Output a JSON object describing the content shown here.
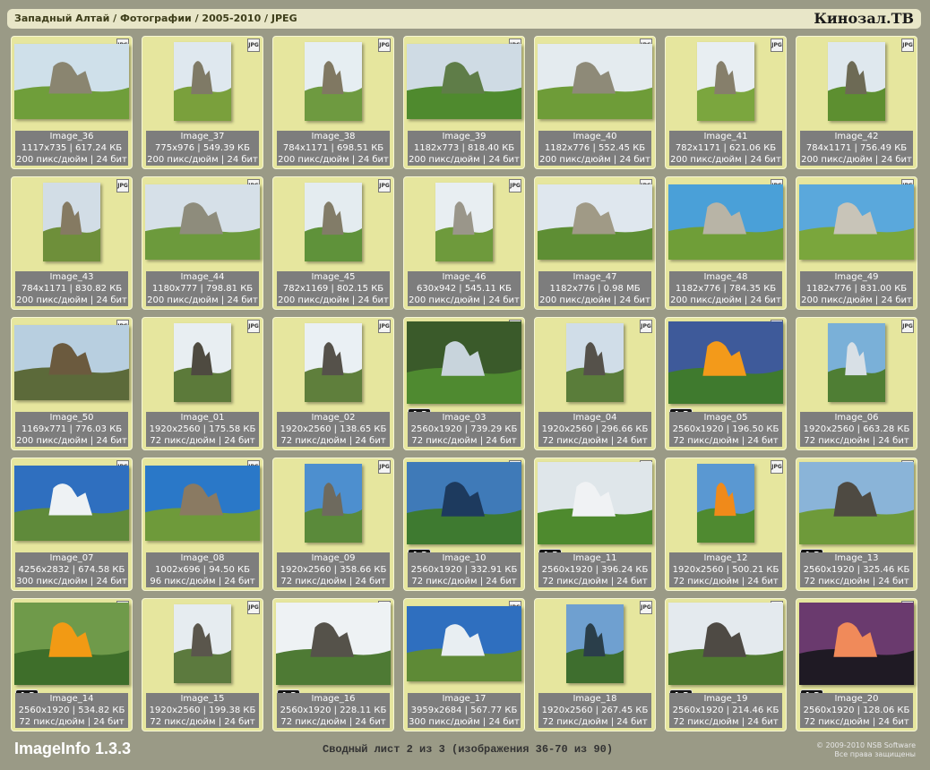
{
  "header": {
    "breadcrumb": "Западный Алтай / Фотографии / 2005-2010 / JPEG",
    "brand": "Кинозал.ТВ"
  },
  "badge_label": "JPG",
  "images": [
    {
      "name": "Image_36",
      "dims": "1117x735 | 617.24 КБ",
      "meta": "200 пикс/дюйм | 24 бит",
      "orient": "land",
      "ratio": "",
      "sky": "#cfe0ea",
      "ground": "#6f9e3a",
      "rock": "#8a8570"
    },
    {
      "name": "Image_37",
      "dims": "775x976 | 549.39 КБ",
      "meta": "200 пикс/дюйм | 24 бит",
      "orient": "port",
      "ratio": "",
      "sky": "#dfe8ef",
      "ground": "#7aa03c",
      "rock": "#7f7a66"
    },
    {
      "name": "Image_38",
      "dims": "784x1171 | 698.51 КБ",
      "meta": "200 пикс/дюйм | 24 бит",
      "orient": "port",
      "ratio": "",
      "sky": "#e6eef2",
      "ground": "#6e9a40",
      "rock": "#807862"
    },
    {
      "name": "Image_39",
      "dims": "1182x773 | 818.40 КБ",
      "meta": "200 пикс/дюйм | 24 бит",
      "orient": "land",
      "ratio": "",
      "sky": "#cfdbe4",
      "ground": "#4f8a2e",
      "rock": "#5f7d48"
    },
    {
      "name": "Image_40",
      "dims": "1182x776 | 552.45 КБ",
      "meta": "200 пикс/дюйм | 24 бит",
      "orient": "land",
      "ratio": "",
      "sky": "#e4ebef",
      "ground": "#6e9c38",
      "rock": "#8e8a78"
    },
    {
      "name": "Image_41",
      "dims": "782x1171 | 621.06 КБ",
      "meta": "200 пикс/дюйм | 24 бит",
      "orient": "port",
      "ratio": "",
      "sky": "#e8eef2",
      "ground": "#7ba63e",
      "rock": "#867f6b"
    },
    {
      "name": "Image_42",
      "dims": "784x1171 | 756.49 КБ",
      "meta": "200 пикс/дюйм | 24 бит",
      "orient": "port",
      "ratio": "",
      "sky": "#dfe8ee",
      "ground": "#5d8f30",
      "rock": "#6d6a55"
    },
    {
      "name": "Image_43",
      "dims": "784x1171 | 830.82 КБ",
      "meta": "200 пикс/дюйм | 24 бит",
      "orient": "port",
      "ratio": "",
      "sky": "#d2dde6",
      "ground": "#6e8f3a",
      "rock": "#857a62"
    },
    {
      "name": "Image_44",
      "dims": "1180x777 | 798.81 КБ",
      "meta": "200 пикс/дюйм | 24 бит",
      "orient": "land",
      "ratio": "",
      "sky": "#d6e0e8",
      "ground": "#6c9a3c",
      "rock": "#8e8c7c"
    },
    {
      "name": "Image_45",
      "dims": "782x1169 | 802.15 КБ",
      "meta": "200 пикс/дюйм | 24 бит",
      "orient": "port",
      "ratio": "",
      "sky": "#e4ecf0",
      "ground": "#5f923a",
      "rock": "#827c68"
    },
    {
      "name": "Image_46",
      "dims": "630x942 | 545.11 КБ",
      "meta": "200 пикс/дюйм | 24 бит",
      "orient": "port",
      "ratio": "",
      "sky": "#e8eef2",
      "ground": "#6e9a3c",
      "rock": "#9a968a"
    },
    {
      "name": "Image_47",
      "dims": "1182x776 | 0.98 МБ",
      "meta": "200 пикс/дюйм | 24 бит",
      "orient": "land",
      "ratio": "",
      "sky": "#dfe7ee",
      "ground": "#5e8e34",
      "rock": "#a09a86"
    },
    {
      "name": "Image_48",
      "dims": "1182x776 | 784.35 КБ",
      "meta": "200 пикс/дюйм | 24 бит",
      "orient": "land",
      "ratio": "",
      "sky": "#4aa0d8",
      "ground": "#6f9e38",
      "rock": "#b8b4a6"
    },
    {
      "name": "Image_49",
      "dims": "1182x776 | 831.00 КБ",
      "meta": "200 пикс/дюйм | 24 бит",
      "orient": "land",
      "ratio": "",
      "sky": "#5aa8dc",
      "ground": "#7aa63c",
      "rock": "#c8c4b8"
    },
    {
      "name": "Image_50",
      "dims": "1169x771 | 776.03 КБ",
      "meta": "200 пикс/дюйм | 24 бит",
      "orient": "land",
      "ratio": "",
      "sky": "#b8cfe0",
      "ground": "#5c6a3a",
      "rock": "#6b5a3e"
    },
    {
      "name": "Image_01",
      "dims": "1920x2560 | 175.58 КБ",
      "meta": "72 пикс/дюйм | 24 бит",
      "orient": "port",
      "ratio": "",
      "sky": "#e8eef2",
      "ground": "#5c7a3a",
      "rock": "#4e4a40"
    },
    {
      "name": "Image_02",
      "dims": "1920x2560 | 138.65 КБ",
      "meta": "72 пикс/дюйм | 24 бит",
      "orient": "port",
      "ratio": "",
      "sky": "#eaf0f4",
      "ground": "#5f7f3c",
      "rock": "#55514a"
    },
    {
      "name": "Image_03",
      "dims": "2560x1920 | 739.29 КБ",
      "meta": "72 пикс/дюйм | 24 бит",
      "orient": "land43",
      "ratio": "4:3",
      "sky": "#3a5a2a",
      "ground": "#4f8a30",
      "rock": "#c8d4dc"
    },
    {
      "name": "Image_04",
      "dims": "1920x2560 | 296.66 КБ",
      "meta": "72 пикс/дюйм | 24 бит",
      "orient": "port",
      "ratio": "",
      "sky": "#d0dde8",
      "ground": "#5a7d3a",
      "rock": "#55514a"
    },
    {
      "name": "Image_05",
      "dims": "2560x1920 | 196.50 КБ",
      "meta": "72 пикс/дюйм | 24 бит",
      "orient": "land43",
      "ratio": "4:3",
      "sky": "#3e5a9a",
      "ground": "#3f7a2e",
      "rock": "#f39a1a"
    },
    {
      "name": "Image_06",
      "dims": "1920x2560 | 663.28 КБ",
      "meta": "72 пикс/дюйм | 24 бит",
      "orient": "port",
      "ratio": "",
      "sky": "#7ab0d8",
      "ground": "#4f7e34",
      "rock": "#d8e0e6"
    },
    {
      "name": "Image_07",
      "dims": "4256x2832 | 674.58 КБ",
      "meta": "300 пикс/дюйм | 24 бит",
      "orient": "land",
      "ratio": "",
      "sky": "#2f6fbf",
      "ground": "#5f8a3a",
      "rock": "#eef2f4"
    },
    {
      "name": "Image_08",
      "dims": "1002x696 | 94.50 КБ",
      "meta": "96 пикс/дюйм | 24 бит",
      "orient": "land",
      "ratio": "",
      "sky": "#2a78c8",
      "ground": "#6e9a3a",
      "rock": "#8a7a62"
    },
    {
      "name": "Image_09",
      "dims": "1920x2560 | 358.66 КБ",
      "meta": "72 пикс/дюйм | 24 бит",
      "orient": "port",
      "ratio": "",
      "sky": "#4d8fcf",
      "ground": "#5a8a3a",
      "rock": "#6e6a5e"
    },
    {
      "name": "Image_10",
      "dims": "2560x1920 | 332.91 КБ",
      "meta": "72 пикс/дюйм | 24 бит",
      "orient": "land43",
      "ratio": "4:3",
      "sky": "#3f7ab8",
      "ground": "#3e7a30",
      "rock": "#1d3a5e"
    },
    {
      "name": "Image_11",
      "dims": "2560x1920 | 396.24 КБ",
      "meta": "72 пикс/дюйм | 24 бит",
      "orient": "land43",
      "ratio": "4:3",
      "sky": "#dfe6ea",
      "ground": "#4e8a2e",
      "rock": "#f0f2f4"
    },
    {
      "name": "Image_12",
      "dims": "1920x2560 | 500.21 КБ",
      "meta": "72 пикс/дюйм | 24 бит",
      "orient": "port",
      "ratio": "",
      "sky": "#5a98d2",
      "ground": "#4f8a30",
      "rock": "#f08a1a"
    },
    {
      "name": "Image_13",
      "dims": "2560x1920 | 325.46 КБ",
      "meta": "72 пикс/дюйм | 24 бит",
      "orient": "land43",
      "ratio": "4:3",
      "sky": "#8ab4d8",
      "ground": "#6e9a3a",
      "rock": "#4e4a42"
    },
    {
      "name": "Image_14",
      "dims": "2560x1920 | 534.82 КБ",
      "meta": "72 пикс/дюйм | 24 бит",
      "orient": "land43",
      "ratio": "4:3",
      "sky": "#6f9a4a",
      "ground": "#3e6e2a",
      "rock": "#f29a14"
    },
    {
      "name": "Image_15",
      "dims": "1920x2560 | 199.38 КБ",
      "meta": "72 пикс/дюйм | 24 бит",
      "orient": "port",
      "ratio": "",
      "sky": "#e6ecf0",
      "ground": "#5c7a3e",
      "rock": "#5a564c"
    },
    {
      "name": "Image_16",
      "dims": "2560x1920 | 228.11 КБ",
      "meta": "72 пикс/дюйм | 24 бит",
      "orient": "land43",
      "ratio": "4:3",
      "sky": "#eef2f4",
      "ground": "#4e7a34",
      "rock": "#55524a"
    },
    {
      "name": "Image_17",
      "dims": "3959x2684 | 567.77 КБ",
      "meta": "300 пикс/дюйм | 24 бит",
      "orient": "land",
      "ratio": "",
      "sky": "#2f6fbf",
      "ground": "#5e8a36",
      "rock": "#e8eef2"
    },
    {
      "name": "Image_18",
      "dims": "1920x2560 | 267.45 КБ",
      "meta": "72 пикс/дюйм | 24 бит",
      "orient": "port",
      "ratio": "",
      "sky": "#6fa0d0",
      "ground": "#3e6e2e",
      "rock": "#2a3e4a"
    },
    {
      "name": "Image_19",
      "dims": "2560x1920 | 214.46 КБ",
      "meta": "72 пикс/дюйм | 24 бит",
      "orient": "land43",
      "ratio": "4:3",
      "sky": "#e4eaee",
      "ground": "#4f7a30",
      "rock": "#4e4a44"
    },
    {
      "name": "Image_20",
      "dims": "2560x1920 | 128.06 КБ",
      "meta": "72 пикс/дюйм | 24 бит",
      "orient": "land43",
      "ratio": "4:3",
      "sky": "#6a3a6e",
      "ground": "#1f1a24",
      "rock": "#f08a5a"
    }
  ],
  "footer": {
    "app_name": "ImageInfo 1.3.3",
    "sheet_info": "Сводный лист 2 из 3 (изображения 36-70 из 90)",
    "copyright": "© 2009-2010 NSB Software",
    "rights": "Все права защищены"
  },
  "colors": {
    "card_bg": "#e6e69e",
    "info_bg": "#7d7d7d",
    "page_bg": "#9a9a86"
  }
}
